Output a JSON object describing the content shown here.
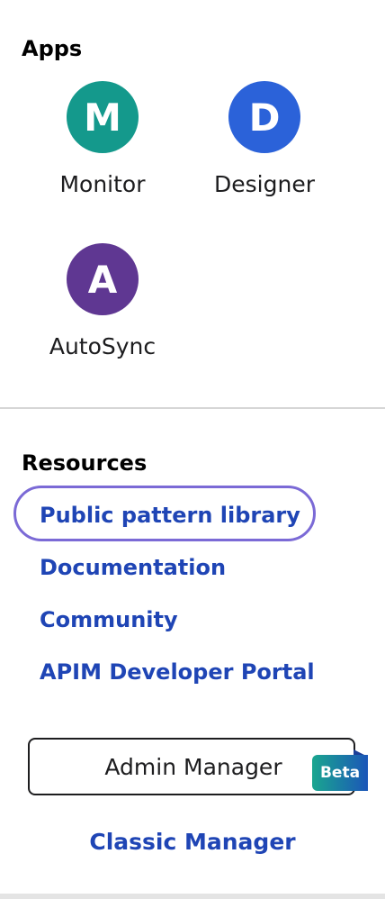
{
  "apps": {
    "heading": "Apps",
    "items": [
      {
        "letter": "M",
        "label": "Monitor",
        "color": "#14998c"
      },
      {
        "letter": "D",
        "label": "Designer",
        "color": "#2b62d9"
      },
      {
        "letter": "A",
        "label": "AutoSync",
        "color": "#5f3792"
      }
    ]
  },
  "resources": {
    "heading": "Resources",
    "links": [
      {
        "label": "Public pattern library"
      },
      {
        "label": "Documentation"
      },
      {
        "label": "Community"
      },
      {
        "label": "APIM Developer Portal"
      }
    ]
  },
  "admin_manager": {
    "label": "Admin Manager",
    "badge": "Beta",
    "badge_color": "#1aa68f",
    "badge_color_end": "#1b56b8"
  },
  "classic_manager": {
    "label": "Classic Manager"
  },
  "colors": {
    "link": "#1f45b5",
    "focus_ring": "#7b6ad6"
  }
}
